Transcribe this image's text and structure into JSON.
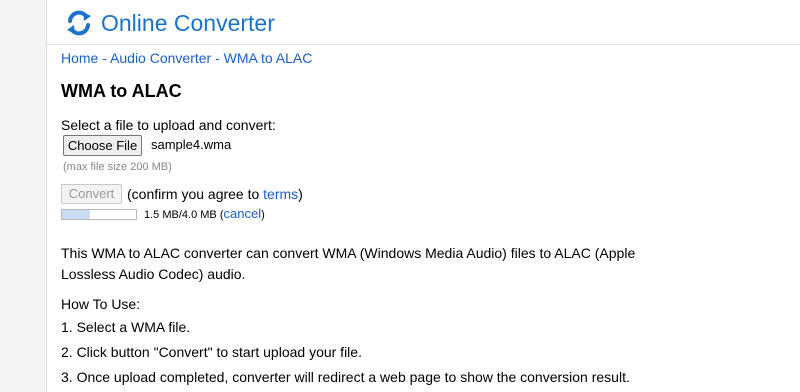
{
  "header": {
    "site_title": "Online Converter",
    "logo_icon": "refresh-arrows-icon",
    "brand_color": "#1a73c9"
  },
  "breadcrumb": {
    "items": [
      "Home",
      "Audio Converter",
      "WMA to ALAC"
    ],
    "separator": " - "
  },
  "main": {
    "title": "WMA to ALAC",
    "select_label": "Select a file to upload and convert:",
    "choose_button_label": "Choose File",
    "file_name": "sample4.wma",
    "max_size_note": "(max file size 200 MB)",
    "convert_button_label": "Convert",
    "confirm_text_before": "(confirm you agree to ",
    "terms_link": "terms",
    "confirm_text_after": ")",
    "progress": {
      "fraction": 0.375,
      "text": "1.5 MB/4.0 MB",
      "cancel_before": " (",
      "cancel_link": "cancel",
      "cancel_after": ")"
    },
    "description": "This WMA to ALAC converter can convert WMA (Windows Media Audio) files to ALAC (Apple Lossless Audio Codec) audio.",
    "howto_title": "How To Use:",
    "steps": [
      "1. Select a WMA file.",
      "2. Click button \"Convert\" to start upload your file.",
      "3. Once upload completed, converter will redirect a web page to show the conversion result."
    ]
  },
  "colors": {
    "link": "#1a5fc6",
    "progress_fill": "#c9dcf3",
    "muted_text": "#888888"
  }
}
